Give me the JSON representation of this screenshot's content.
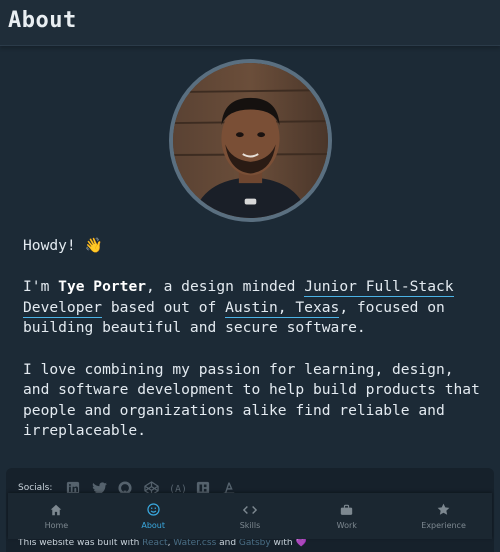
{
  "header": {
    "title": "About"
  },
  "avatar": {
    "alt": "Tye Porter"
  },
  "bio": {
    "greeting": "Howdy! 👋",
    "p2_intro": "I'm ",
    "p2_name": "Tye Porter",
    "p2_mid": ", a design minded ",
    "p2_role": "Junior Full-Stack Developer",
    "p2_based": " based out of ",
    "p2_location": "Austin, Texas",
    "p2_end": ", focused on building beautiful and secure software.",
    "p3": "I love combining my passion for learning, design, and software development to help build products that people and organizations alike find reliable and irreplaceable."
  },
  "footer": {
    "socials_label": "Socials:",
    "socials": [
      "linkedin-icon",
      "twitter-icon",
      "github-icon",
      "codepen-icon",
      "angellist-icon",
      "stackshare-icon",
      "gitlab-icon"
    ],
    "built_prefix": "This website was built with ",
    "built_tech1": "React",
    "built_sep": ", ",
    "built_tech2": "Water.css",
    "built_and": " and ",
    "built_tech3": "Gatsby",
    "built_with": " with ",
    "built_heart": "💜"
  },
  "nav": {
    "items": [
      {
        "label": "Home",
        "icon": "home-icon",
        "active": false
      },
      {
        "label": "About",
        "icon": "smiley-icon",
        "active": true
      },
      {
        "label": "Skills",
        "icon": "code-icon",
        "active": false
      },
      {
        "label": "Work",
        "icon": "briefcase-icon",
        "active": false
      },
      {
        "label": "Experience",
        "icon": "star-icon",
        "active": false
      }
    ]
  },
  "colors": {
    "accent": "#3aa9e0",
    "background": "#1c2a36",
    "link_underline": "#4bb3e6"
  }
}
